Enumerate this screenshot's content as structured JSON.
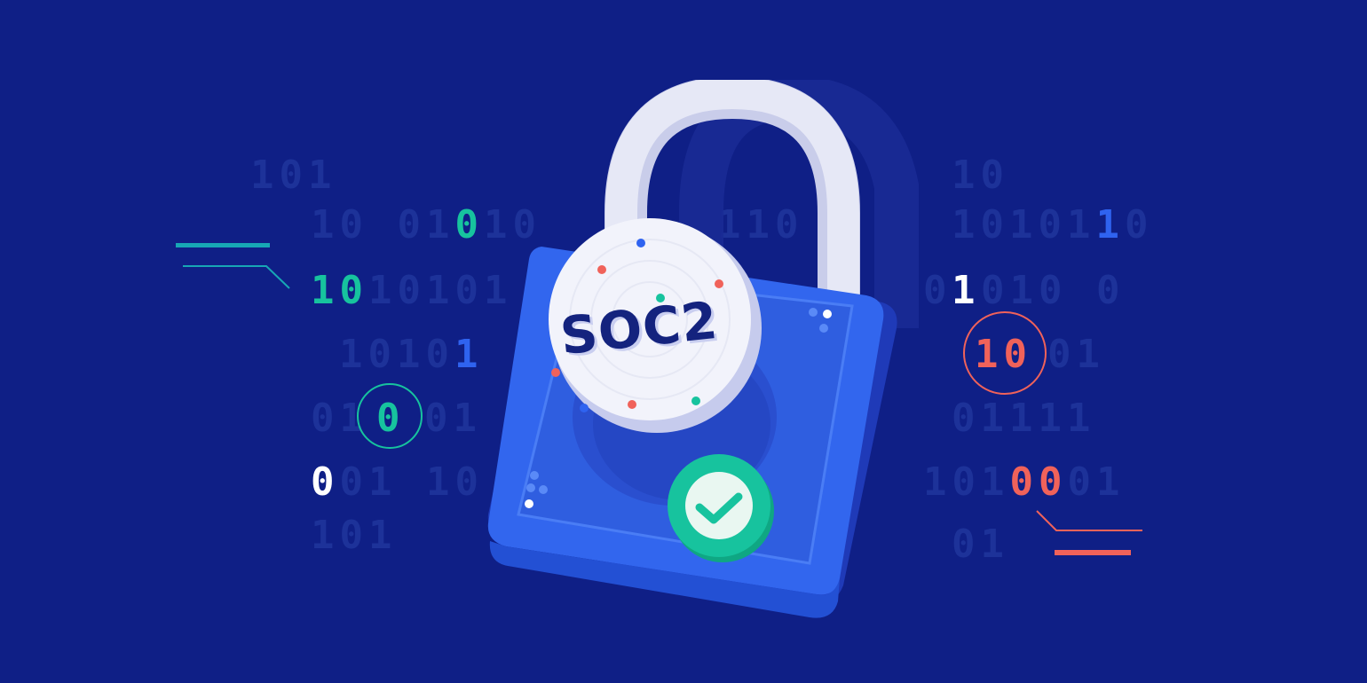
{
  "badge": "SOC2",
  "binary_left": {
    "row1": "101",
    "row2_a": "10 01",
    "row2_hl": "0",
    "row2_b": "10",
    "row3_hl": "10",
    "row3_b": "10101",
    "row4_a": "1010",
    "row4_hl": "1",
    "row5_a": "01",
    "row5_b": "01",
    "row5_circle": "0",
    "row6_hl": "0",
    "row6_b": "01 10",
    "row7": "101"
  },
  "binary_center": {
    "row1": "110"
  },
  "binary_right": {
    "row1": "10",
    "row2_a": "10101",
    "row2_hl": "1",
    "row2_b": "0",
    "row3_hl": "1",
    "row3_a": "01010 0",
    "row4_circle": "10",
    "row4_b": "01",
    "row5": "01111",
    "row6_a": "101",
    "row6_hl": "00",
    "row6_b": "01",
    "row7": "01"
  },
  "colors": {
    "background": "#0f1f86",
    "dim_digits": "#1d3299",
    "teal": "#17c39e",
    "blue": "#2f63f0",
    "coral": "#f0625a",
    "lock_body": "#3266ee",
    "shackle": "#e6e8f6"
  },
  "icons": {
    "lock": "padlock-icon",
    "check": "checkmark-icon"
  }
}
